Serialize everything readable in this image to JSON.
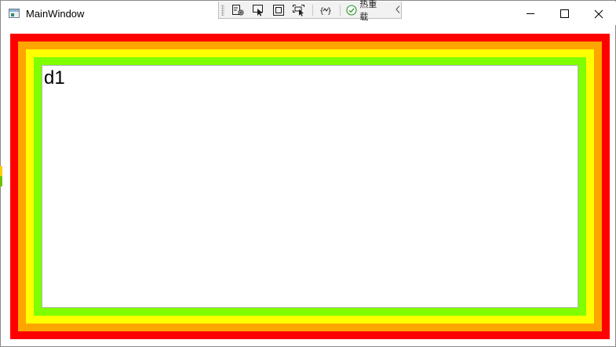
{
  "window": {
    "title": "MainWindow",
    "controls": {
      "minimize_icon": "minimize-icon",
      "maximize_icon": "maximize-icon",
      "close_icon": "close-icon"
    }
  },
  "debug_toolbar": {
    "buttons": [
      {
        "name": "live-visual-tree-icon"
      },
      {
        "name": "select-element-icon"
      },
      {
        "name": "display-layout-adorners-icon"
      },
      {
        "name": "track-focused-element-icon"
      },
      {
        "name": "binding-failures-icon"
      }
    ],
    "hot_reload_label": "热重载",
    "collapse_icon": "chevron-left-icon"
  },
  "content": {
    "label": "d1"
  },
  "colors": {
    "border_1": "#ff0000",
    "border_2": "#ffa500",
    "border_3": "#ffff00",
    "border_4": "#7fff00",
    "inner_background": "#ffffff"
  }
}
